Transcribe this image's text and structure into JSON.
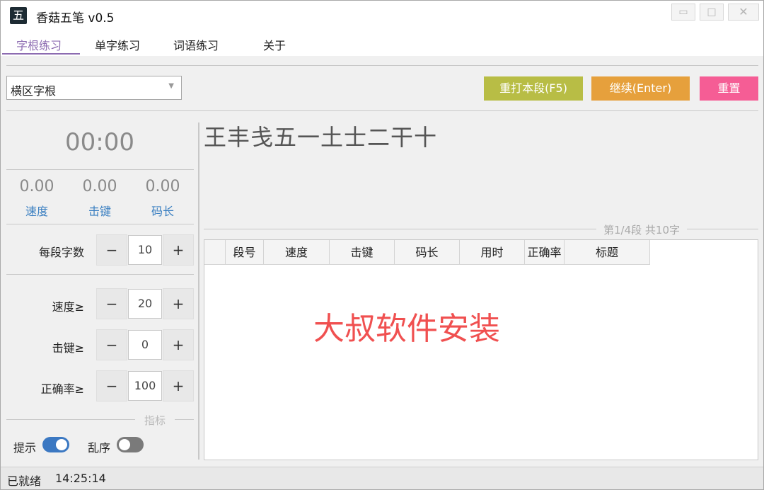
{
  "window": {
    "title": "香菇五笔 v0.5",
    "icon_glyph": "五",
    "controls": {
      "min": "▭",
      "max": "□",
      "close": "✕"
    }
  },
  "tabs": [
    {
      "label": "字根练习",
      "active": true
    },
    {
      "label": "单字练习",
      "active": false
    },
    {
      "label": "词语练习",
      "active": false
    },
    {
      "label": "关于",
      "active": false
    }
  ],
  "toolbar": {
    "select_value": "横区字根",
    "retype_label": "重打本段(F5)",
    "continue_label": "继续(Enter)",
    "reset_label": "重置"
  },
  "stats": {
    "timer": "00:00",
    "speed_value": "0.00",
    "speed_label": "速度",
    "keystroke_value": "0.00",
    "keystroke_label": "击键",
    "codelen_value": "0.00",
    "codelen_label": "码长"
  },
  "settings": {
    "chars_per_segment": {
      "label": "每段字数",
      "value": "10"
    },
    "speed_min": {
      "label": "速度≥",
      "value": "20"
    },
    "keystroke_min": {
      "label": "击键≥",
      "value": "0"
    },
    "accuracy_min": {
      "label": "正确率≥",
      "value": "100"
    },
    "minus": "−",
    "plus": "+"
  },
  "indicator_legend": "指标",
  "toggles": {
    "hint": {
      "label": "提示",
      "on": true
    },
    "shuffle": {
      "label": "乱序",
      "on": false
    }
  },
  "practice_text": "王丰戋五一土士二干十",
  "page_info": "第1/4段 共10字",
  "table": {
    "columns": [
      "",
      "段号",
      "速度",
      "击键",
      "码长",
      "用时",
      "正确率",
      "标题"
    ],
    "rows": []
  },
  "watermark": "大叔软件安装",
  "statusbar": {
    "status": "已就绪",
    "time": "14:25:14"
  },
  "colors": {
    "accent_tab": "#8c6bb1",
    "retype_button": "#b8bd45",
    "continue_button": "#e6a03c",
    "reset_button": "#f55d95",
    "stat_label": "#3a7fc1",
    "toggle_on": "#3b78c2",
    "watermark": "#f05050"
  }
}
